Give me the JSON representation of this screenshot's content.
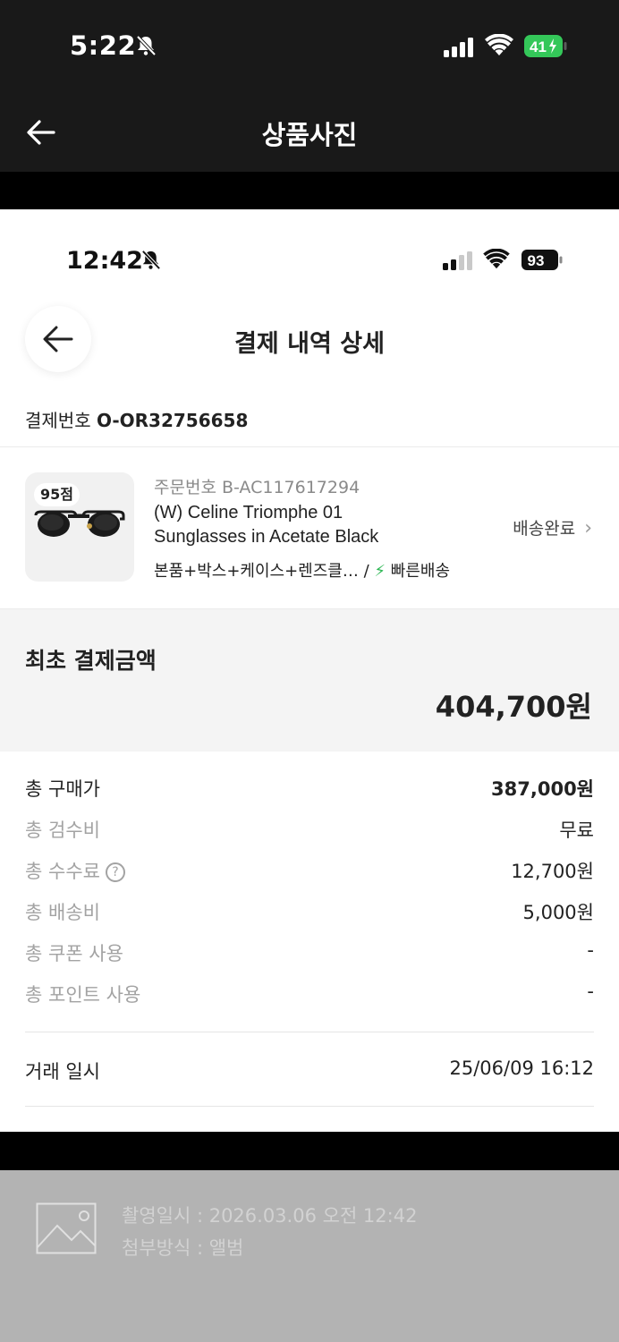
{
  "outer": {
    "status": {
      "time": "5:22",
      "battery": "41"
    },
    "header": {
      "title": "상품사진"
    }
  },
  "shot": {
    "status": {
      "time": "12:42",
      "battery": "93"
    },
    "header": {
      "title": "결제 내역 상세"
    },
    "payment_no": {
      "label": "결제번호",
      "value": "O-OR32756658"
    },
    "product": {
      "grade": "95점",
      "order_no": "주문번호 B-AC117617294",
      "name_line1": "(W) Celine Triomphe 01",
      "name_line2": "Sunglasses in Acetate Black",
      "options": "본품+박스+케이스+렌즈클…",
      "separator": "/",
      "bolt": "⚡",
      "fast_delivery": "빠른배송",
      "ship_status": "배송완료"
    },
    "initial_payment": {
      "label": "최초 결제금액",
      "amount": "404,700원"
    },
    "breakdown": [
      {
        "label": "총 구매가",
        "value": "387,000원"
      },
      {
        "label": "총 검수비",
        "value": "무료"
      },
      {
        "label": "총 수수료",
        "value": "12,700원"
      },
      {
        "label": "총 배송비",
        "value": "5,000원"
      },
      {
        "label": "총 쿠폰 사용",
        "value": "-"
      },
      {
        "label": "총 포인트 사용",
        "value": "-"
      }
    ],
    "help_glyph": "?",
    "trade": {
      "label": "거래 일시",
      "value": "25/06/09 16:12"
    }
  },
  "footer": {
    "captured": "촬영일시 : 2026.03.06 오전 12:42",
    "attach": "첨부방식 : 앨범"
  },
  "colors": {
    "accent_green": "#30b856",
    "dark_chrome": "#191919",
    "battery_green": "#34c759"
  }
}
